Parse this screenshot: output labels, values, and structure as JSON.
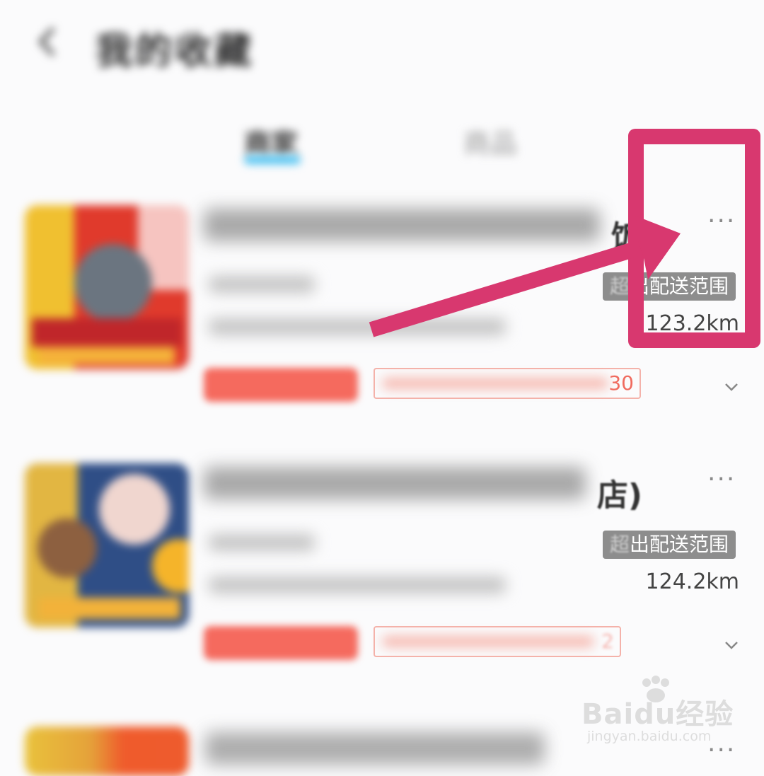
{
  "header": {
    "title": "我的收藏"
  },
  "tabs": [
    {
      "label": "商家"
    },
    {
      "label": "商品"
    }
  ],
  "stores": [
    {
      "name_visible_tail": "饭",
      "out_of_range": "超出配送范围",
      "distance": "123.2km",
      "promo_tail": "30",
      "more_icon": "more-dots-icon"
    },
    {
      "name_visible_tail": "店)",
      "out_of_range": "超出配送范围",
      "distance": "124.2km",
      "promo_tail": "2",
      "more_icon": "more-dots-icon"
    }
  ],
  "watermark": {
    "brand": "Baidu经验",
    "url": "jingyan.baidu.com"
  },
  "colors": {
    "highlight": "#d8386f",
    "tab_indicator": "#4cc3f3",
    "promo": "#f56a5e",
    "badge": "#8d8d8d"
  }
}
